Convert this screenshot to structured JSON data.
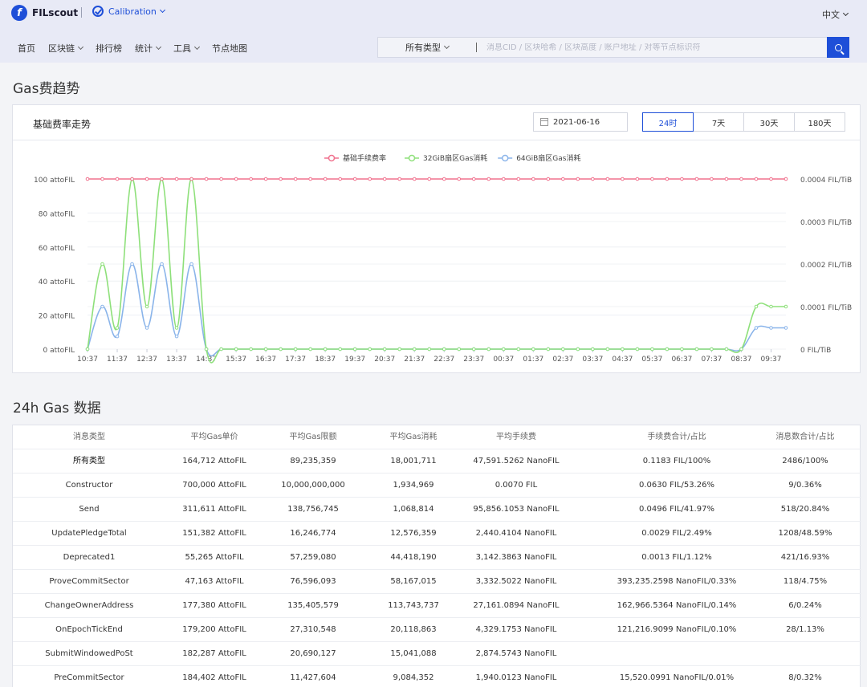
{
  "header": {
    "logo": "FILscout",
    "network": "Calibration",
    "language": "中文"
  },
  "nav": {
    "items": [
      {
        "label": "首页",
        "dropdown": false
      },
      {
        "label": "区块链",
        "dropdown": true
      },
      {
        "label": "排行榜",
        "dropdown": false
      },
      {
        "label": "统计",
        "dropdown": true
      },
      {
        "label": "工具",
        "dropdown": true
      },
      {
        "label": "节点地图",
        "dropdown": false
      }
    ]
  },
  "search": {
    "type": "所有类型",
    "placeholder": "消息CID / 区块哈希 / 区块高度 / 账户地址 / 对等节点标识符"
  },
  "trend": {
    "section_title": "Gas费趋势",
    "card_title": "基础费率走势",
    "date": "2021-06-16",
    "ranges": [
      "24时",
      "7天",
      "30天",
      "180天"
    ],
    "active_range": "24时"
  },
  "chart_data": {
    "type": "line",
    "legend_position": "top",
    "x": [
      "10:37",
      "11:07",
      "11:37",
      "12:07",
      "12:37",
      "13:07",
      "13:37",
      "14:07",
      "14:37",
      "15:07",
      "15:37",
      "16:07",
      "16:37",
      "17:07",
      "17:37",
      "18:07",
      "18:37",
      "19:07",
      "19:37",
      "20:07",
      "20:37",
      "21:07",
      "21:37",
      "22:07",
      "22:37",
      "23:07",
      "23:37",
      "00:07",
      "00:37",
      "01:07",
      "01:37",
      "02:07",
      "02:37",
      "03:07",
      "03:37",
      "04:07",
      "04:37",
      "05:07",
      "05:37",
      "06:07",
      "06:37",
      "07:07",
      "07:37",
      "08:07",
      "08:37",
      "09:07",
      "09:37",
      "10:07"
    ],
    "x_tick_labels": [
      "10:37",
      "11:37",
      "12:37",
      "13:37",
      "14:37",
      "15:37",
      "16:37",
      "17:37",
      "18:37",
      "19:37",
      "20:37",
      "21:37",
      "22:37",
      "23:37",
      "00:37",
      "01:37",
      "02:37",
      "03:37",
      "04:37",
      "05:37",
      "06:37",
      "07:37",
      "08:37",
      "09:37"
    ],
    "y_left": {
      "ticks": [
        "0 attoFIL",
        "20 attoFIL",
        "40 attoFIL",
        "60 attoFIL",
        "80 attoFIL",
        "100 attoFIL"
      ],
      "range": [
        0,
        100
      ]
    },
    "y_right": {
      "ticks": [
        "0 FIL/TiB",
        "0.0001 FIL/TiB",
        "0.0002 FIL/TiB",
        "0.0003 FIL/TiB",
        "0.0004 FIL/TiB"
      ],
      "range": [
        0,
        0.0004
      ]
    },
    "series": [
      {
        "name": "基础手续费率",
        "axis": "left",
        "color": "#f0728e",
        "values": [
          100,
          100,
          100,
          100,
          100,
          100,
          100,
          100,
          100,
          100,
          100,
          100,
          100,
          100,
          100,
          100,
          100,
          100,
          100,
          100,
          100,
          100,
          100,
          100,
          100,
          100,
          100,
          100,
          100,
          100,
          100,
          100,
          100,
          100,
          100,
          100,
          100,
          100,
          100,
          100,
          100,
          100,
          100,
          100,
          100,
          100,
          100,
          100
        ]
      },
      {
        "name": "32GiB扇区Gas消耗",
        "axis": "right",
        "color": "#8ee07a",
        "values": [
          0,
          0.0002,
          5e-05,
          0.0004,
          0.0001,
          0.0004,
          5e-05,
          0.0004,
          0,
          0,
          0,
          0,
          0,
          0,
          0,
          0,
          0,
          0,
          0,
          0,
          0,
          0,
          0,
          0,
          0,
          0,
          0,
          0,
          0,
          0,
          0,
          0,
          0,
          0,
          0,
          0,
          0,
          0,
          0,
          0,
          0,
          0,
          0,
          0,
          0,
          0.0001,
          0.0001,
          0.0001
        ]
      },
      {
        "name": "64GiB扇区Gas消耗",
        "axis": "right",
        "color": "#8ab4ea",
        "values": [
          0,
          0.0001,
          3e-05,
          0.0002,
          5e-05,
          0.0002,
          3e-05,
          0.0002,
          0,
          0,
          0,
          0,
          0,
          0,
          0,
          0,
          0,
          0,
          0,
          0,
          0,
          0,
          0,
          0,
          0,
          0,
          0,
          0,
          0,
          0,
          0,
          0,
          0,
          0,
          0,
          0,
          0,
          0,
          0,
          0,
          0,
          0,
          0,
          0,
          0,
          5e-05,
          5e-05,
          5e-05
        ]
      }
    ]
  },
  "gas_table": {
    "section_title": "24h Gas 数据",
    "columns": [
      "消息类型",
      "平均Gas单价",
      "平均Gas限额",
      "平均Gas消耗",
      "平均手续费",
      "手续费合计/占比",
      "消息数合计/占比"
    ],
    "rows": [
      [
        "所有类型",
        "164,712 AttoFIL",
        "89,235,359",
        "18,001,711",
        "47,591.5262 NanoFIL",
        "0.1183 FIL/100%",
        "2486/100%"
      ],
      [
        "Constructor",
        "700,000 AttoFIL",
        "10,000,000,000",
        "1,934,969",
        "0.0070 FIL",
        "0.0630 FIL/53.26%",
        "9/0.36%"
      ],
      [
        "Send",
        "311,611 AttoFIL",
        "138,756,745",
        "1,068,814",
        "95,856.1053 NanoFIL",
        "0.0496 FIL/41.97%",
        "518/20.84%"
      ],
      [
        "UpdatePledgeTotal",
        "151,382 AttoFIL",
        "16,246,774",
        "12,576,359",
        "2,440.4104 NanoFIL",
        "0.0029 FIL/2.49%",
        "1208/48.59%"
      ],
      [
        "Deprecated1",
        "55,265 AttoFIL",
        "57,259,080",
        "44,418,190",
        "3,142.3863 NanoFIL",
        "0.0013 FIL/1.12%",
        "421/16.93%"
      ],
      [
        "ProveCommitSector",
        "47,163 AttoFIL",
        "76,596,093",
        "58,167,015",
        "3,332.5022 NanoFIL",
        "393,235.2598 NanoFIL/0.33%",
        "118/4.75%"
      ],
      [
        "ChangeOwnerAddress",
        "177,380 AttoFIL",
        "135,405,579",
        "113,743,737",
        "27,161.0894 NanoFIL",
        "162,966.5364 NanoFIL/0.14%",
        "6/0.24%"
      ],
      [
        "OnEpochTickEnd",
        "179,200 AttoFIL",
        "27,310,548",
        "20,118,863",
        "4,329.1753 NanoFIL",
        "121,216.9099 NanoFIL/0.10%",
        "28/1.13%"
      ],
      [
        "SubmitWindowedPoSt",
        "182,287 AttoFIL",
        "20,690,127",
        "15,041,088",
        "2,874.5743 NanoFIL",
        "",
        ""
      ],
      [
        "PreCommitSector",
        "184,402 AttoFIL",
        "11,427,604",
        "9,084,352",
        "1,940.0123 NanoFIL",
        "15,520.0991 NanoFIL/0.01%",
        "8/0.32%"
      ]
    ]
  }
}
